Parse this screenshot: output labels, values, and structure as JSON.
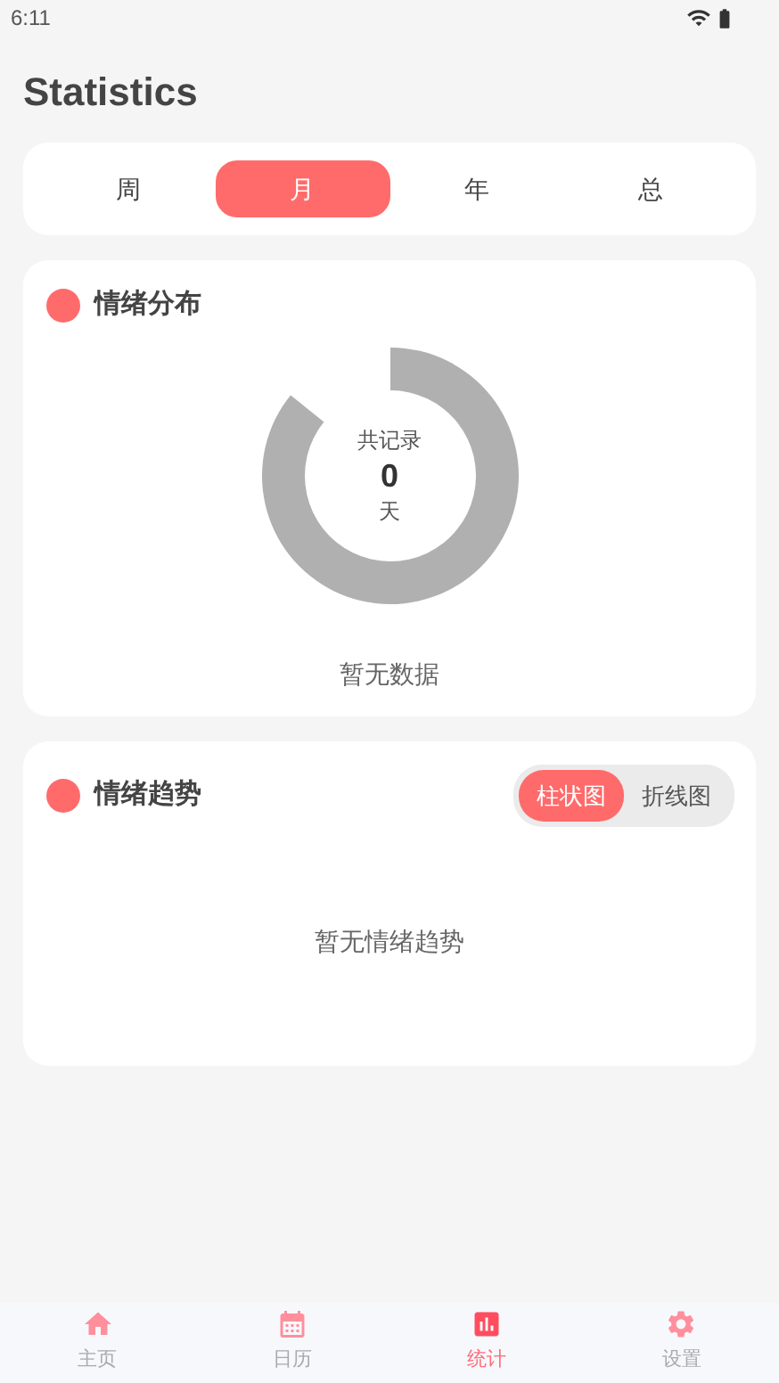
{
  "status_bar": {
    "time": "6:11"
  },
  "title": "Statistics",
  "tabs": [
    {
      "label": "周",
      "selected": false
    },
    {
      "label": "月",
      "selected": true
    },
    {
      "label": "年",
      "selected": false
    },
    {
      "label": "总",
      "selected": false
    }
  ],
  "distribution": {
    "title": "情绪分布",
    "total_label": "共记录",
    "total": "0",
    "unit": "天",
    "empty": "暂无数据"
  },
  "trend": {
    "title": "情绪趋势",
    "toggle": [
      {
        "label": "柱状图",
        "selected": true
      },
      {
        "label": "折线图",
        "selected": false
      }
    ],
    "empty": "暂无情绪趋势"
  },
  "nav": [
    {
      "kind": "home",
      "label": "主页",
      "selected": false
    },
    {
      "kind": "calendar",
      "label": "日历",
      "selected": false
    },
    {
      "kind": "stats",
      "label": "统计",
      "selected": true
    },
    {
      "kind": "settings",
      "label": "设置",
      "selected": false
    }
  ]
}
